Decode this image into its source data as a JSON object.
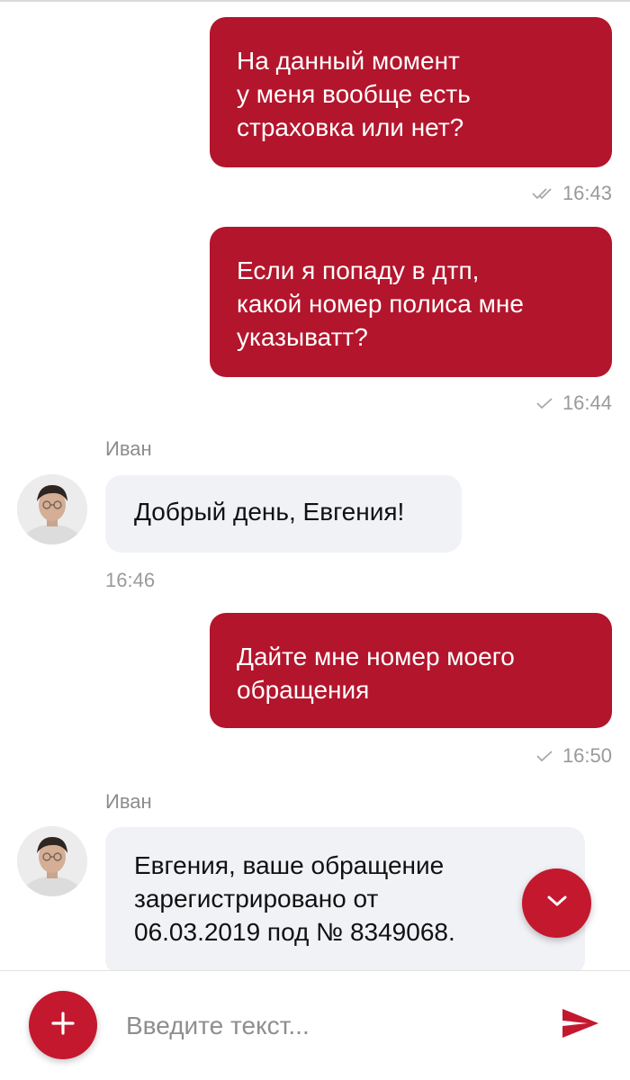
{
  "colors": {
    "accent": "#c4182f",
    "outgoing_bubble": "#b3152c",
    "incoming_bubble": "#f1f2f6",
    "meta_text": "#9a9a9a"
  },
  "messages": [
    {
      "direction": "outgoing",
      "text": "На данный момент\nу меня вообще есть\nстраховка или нет?",
      "time": "16:43",
      "status": "read",
      "status_icon": "double-check-icon"
    },
    {
      "direction": "outgoing",
      "text": "Если я попаду в дтп,\nкакой номер полиса мне\nуказыватт?",
      "time": "16:44",
      "status": "sent",
      "status_icon": "check-icon"
    },
    {
      "direction": "incoming",
      "sender": "Иван",
      "text": "Добрый день, Евгения!",
      "time": "16:46"
    },
    {
      "direction": "outgoing",
      "text": "Дайте мне номер моего\nобращения",
      "time": "16:50",
      "status": "sent",
      "status_icon": "check-icon"
    },
    {
      "direction": "incoming",
      "sender": "Иван",
      "text": "Евгения, ваше обращение\nзарегистрировано от\n06.03.2019 под № 8349068."
    }
  ],
  "composer": {
    "placeholder": "Введите текст...",
    "value": "",
    "add_icon": "plus-icon",
    "send_icon": "send-icon"
  },
  "scroll_button": {
    "icon": "chevron-down-icon"
  }
}
